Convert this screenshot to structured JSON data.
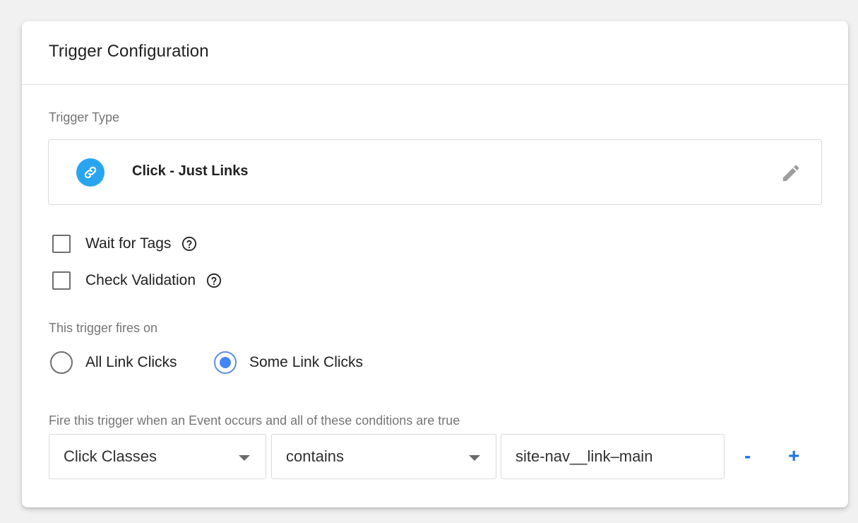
{
  "card": {
    "title": "Trigger Configuration"
  },
  "trigger_type": {
    "label": "Trigger Type",
    "name": "Click - Just Links",
    "icon": "link-icon",
    "icon_color": "#29a5f0",
    "edit_icon": "pencil-icon"
  },
  "options": [
    {
      "label": "Wait for Tags",
      "checked": false,
      "help_icon": "help-circle-icon"
    },
    {
      "label": "Check Validation",
      "checked": false,
      "help_icon": "help-circle-icon"
    }
  ],
  "fires_on": {
    "label": "This trigger fires on",
    "choices": [
      {
        "label": "All Link Clicks",
        "selected": false
      },
      {
        "label": "Some Link Clicks",
        "selected": true
      }
    ]
  },
  "conditions": {
    "label": "Fire this trigger when an Event occurs and all of these conditions are true",
    "rows": [
      {
        "variable": "Click Classes",
        "operator": "contains",
        "value": "site-nav__link–main",
        "remove_label": "-",
        "add_label": "+"
      }
    ]
  },
  "colors": {
    "accent": "#1a73e8",
    "radio_selected": "#4285f4"
  }
}
